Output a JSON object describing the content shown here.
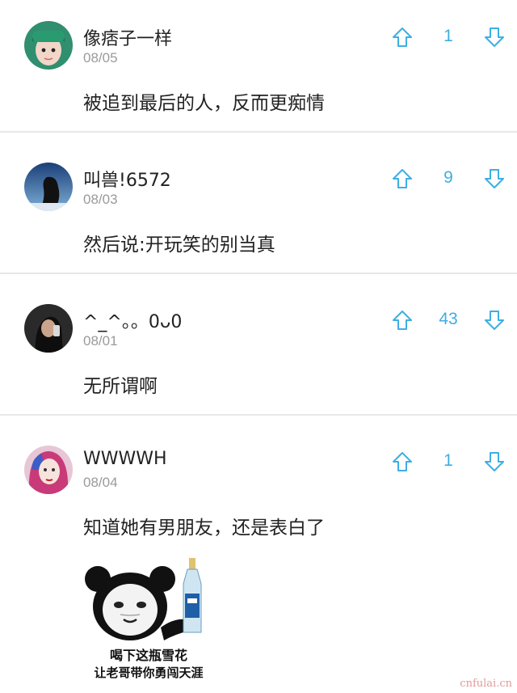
{
  "comments": [
    {
      "username": "像痞子一样",
      "date": "08/05",
      "text": "被追到最后的人，反而更痴情",
      "votes": "1"
    },
    {
      "username": "叫兽!6572",
      "date": "08/03",
      "text": "然后说:开玩笑的别当真",
      "votes": "9"
    },
    {
      "username": "^_^。。0ᴗ0",
      "date": "08/01",
      "text": "无所谓啊",
      "votes": "43"
    },
    {
      "username": "WWWWH",
      "date": "08/04",
      "text": "知道她有男朋友，还是表白了",
      "votes": "1"
    }
  ],
  "meme": {
    "line1": "喝下这瓶雪花",
    "line2": "让老哥带你勇闯天涯"
  },
  "watermark": "cnfulai.cn",
  "icons": {
    "upvote": "arrow-up-icon",
    "downvote": "arrow-down-icon"
  },
  "colors": {
    "accent": "#3eaee3",
    "muted": "#9a9a9a",
    "divider": "#e8e8e8"
  }
}
